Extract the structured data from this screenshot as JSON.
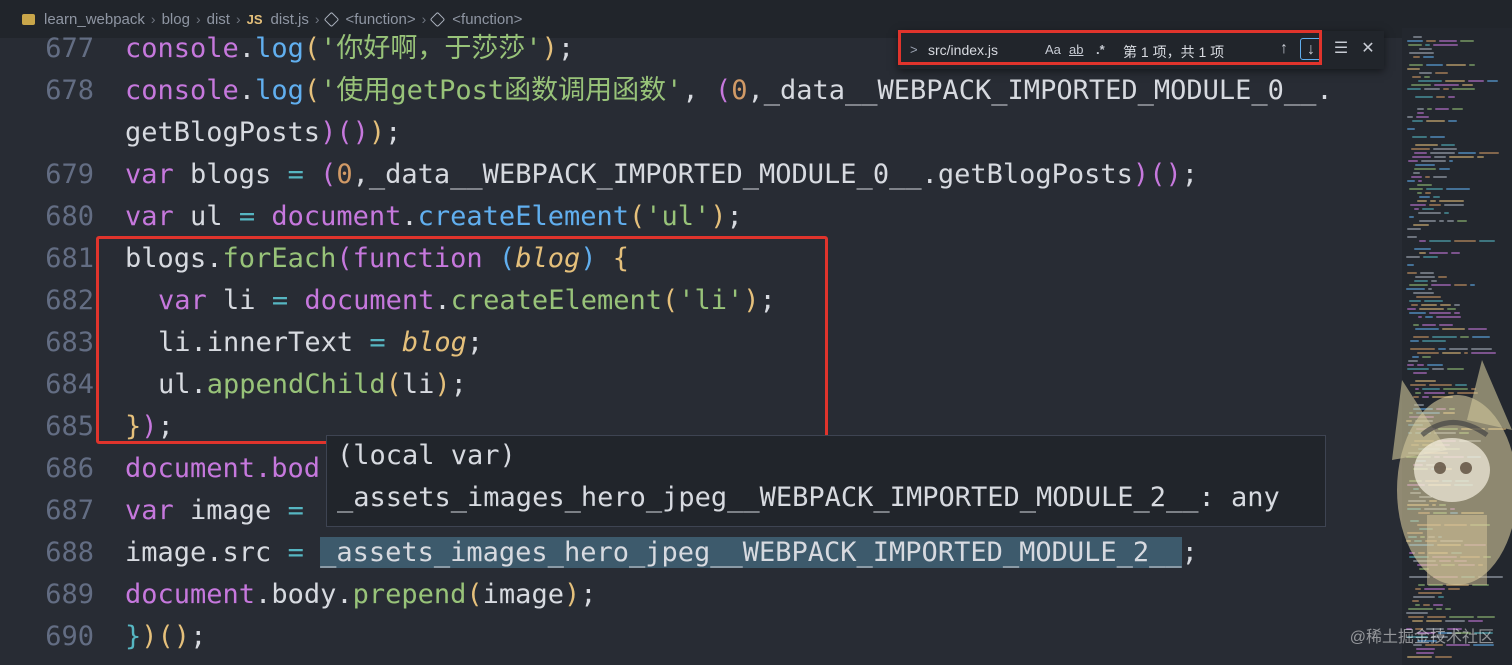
{
  "breadcrumb": {
    "folder": "learn_webpack",
    "parts": [
      "blog",
      "dist"
    ],
    "file": "dist.js",
    "js_label": "JS",
    "functions": [
      "<function>",
      "<function>"
    ]
  },
  "code": {
    "line_numbers": [
      "677",
      "678",
      "679",
      "680",
      "681",
      "682",
      "683",
      "684",
      "685",
      "686",
      "687",
      "688",
      "689",
      "690"
    ],
    "l677": [
      "console",
      ".",
      "log",
      "(",
      "'你好啊，于莎莎'",
      ")",
      ";"
    ],
    "l678": [
      "console",
      ".",
      "log",
      "(",
      "'使用getPost函数调用函数'",
      ", ",
      "(",
      "0",
      ",_data__WEBPACK_IMPORTED_MODULE_0__."
    ],
    "l678b": [
      "getBlogPosts",
      ")",
      "(",
      ")",
      ")",
      ";"
    ],
    "l679": [
      "var",
      " blogs ",
      "=",
      " ",
      "(",
      "0",
      ",_data__WEBPACK_IMPORTED_MODULE_0__.",
      "getBlogPosts",
      ")",
      "(",
      ")",
      ";"
    ],
    "l680": [
      "var",
      " ul ",
      "=",
      " document",
      ".",
      "createElement",
      "(",
      "'ul'",
      ")",
      ";"
    ],
    "l681": [
      "blogs",
      ".",
      "forEach",
      "(",
      "function",
      " ",
      "(",
      "blog",
      ")",
      " {"
    ],
    "l682": [
      "var",
      " li ",
      "=",
      " document",
      ".",
      "createElement",
      "(",
      "'li'",
      ")",
      ";"
    ],
    "l683": [
      "li",
      ".",
      "innerText",
      " = ",
      "blog",
      ";"
    ],
    "l684": [
      "ul",
      ".",
      "appendChild",
      "(",
      "li",
      ")",
      ";"
    ],
    "l685": [
      "}",
      ")",
      ";"
    ],
    "l686": "document.bod",
    "l687": [
      "var",
      " image ",
      "="
    ],
    "l688": [
      "image",
      ".",
      "src",
      " = ",
      "_assets_images_hero_jpeg__WEBPACK_IMPORTED_MODULE_2__",
      ";"
    ],
    "l689": [
      "document",
      ".",
      "body",
      ".",
      "prepend",
      "(",
      "image",
      ")",
      ";"
    ],
    "l690": [
      "}",
      ")",
      "(",
      ")",
      ";"
    ]
  },
  "find": {
    "chevron": ">",
    "value": "src/index.js",
    "opt_case": "Aa",
    "opt_word": "ab",
    "opt_regex": ".*",
    "count": "第 1 项，共 1 项",
    "prev": "↑",
    "next": "↓",
    "menu": "☰",
    "close": "✕"
  },
  "tooltip": {
    "line1": "(local var)",
    "line2": "_assets_images_hero_jpeg__WEBPACK_IMPORTED_MODULE_2__: any"
  },
  "watermark": "@稀土掘金技术社区",
  "colors": {
    "background": "#282c34",
    "highlight": "#e0342c",
    "keyword": "#c678dd",
    "function": "#61afef",
    "string": "#98c379",
    "number": "#d19a66"
  }
}
